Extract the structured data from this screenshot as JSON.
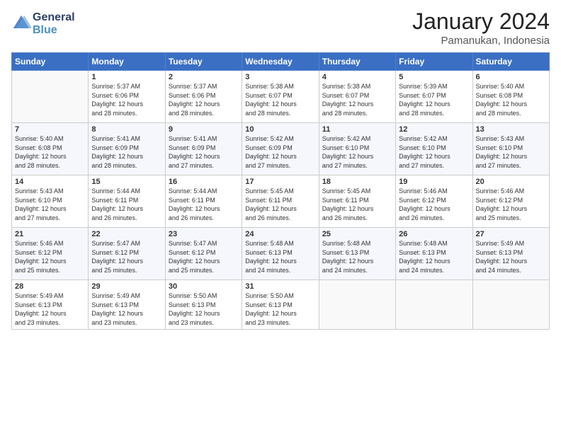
{
  "header": {
    "logo_line1": "General",
    "logo_line2": "Blue",
    "month_year": "January 2024",
    "location": "Pamanukan, Indonesia"
  },
  "days_of_week": [
    "Sunday",
    "Monday",
    "Tuesday",
    "Wednesday",
    "Thursday",
    "Friday",
    "Saturday"
  ],
  "weeks": [
    [
      {
        "day": "",
        "info": ""
      },
      {
        "day": "1",
        "info": "Sunrise: 5:37 AM\nSunset: 6:06 PM\nDaylight: 12 hours\nand 28 minutes."
      },
      {
        "day": "2",
        "info": "Sunrise: 5:37 AM\nSunset: 6:06 PM\nDaylight: 12 hours\nand 28 minutes."
      },
      {
        "day": "3",
        "info": "Sunrise: 5:38 AM\nSunset: 6:07 PM\nDaylight: 12 hours\nand 28 minutes."
      },
      {
        "day": "4",
        "info": "Sunrise: 5:38 AM\nSunset: 6:07 PM\nDaylight: 12 hours\nand 28 minutes."
      },
      {
        "day": "5",
        "info": "Sunrise: 5:39 AM\nSunset: 6:07 PM\nDaylight: 12 hours\nand 28 minutes."
      },
      {
        "day": "6",
        "info": "Sunrise: 5:40 AM\nSunset: 6:08 PM\nDaylight: 12 hours\nand 28 minutes."
      }
    ],
    [
      {
        "day": "7",
        "info": "Sunrise: 5:40 AM\nSunset: 6:08 PM\nDaylight: 12 hours\nand 28 minutes."
      },
      {
        "day": "8",
        "info": "Sunrise: 5:41 AM\nSunset: 6:09 PM\nDaylight: 12 hours\nand 28 minutes."
      },
      {
        "day": "9",
        "info": "Sunrise: 5:41 AM\nSunset: 6:09 PM\nDaylight: 12 hours\nand 27 minutes."
      },
      {
        "day": "10",
        "info": "Sunrise: 5:42 AM\nSunset: 6:09 PM\nDaylight: 12 hours\nand 27 minutes."
      },
      {
        "day": "11",
        "info": "Sunrise: 5:42 AM\nSunset: 6:10 PM\nDaylight: 12 hours\nand 27 minutes."
      },
      {
        "day": "12",
        "info": "Sunrise: 5:42 AM\nSunset: 6:10 PM\nDaylight: 12 hours\nand 27 minutes."
      },
      {
        "day": "13",
        "info": "Sunrise: 5:43 AM\nSunset: 6:10 PM\nDaylight: 12 hours\nand 27 minutes."
      }
    ],
    [
      {
        "day": "14",
        "info": "Sunrise: 5:43 AM\nSunset: 6:10 PM\nDaylight: 12 hours\nand 27 minutes."
      },
      {
        "day": "15",
        "info": "Sunrise: 5:44 AM\nSunset: 6:11 PM\nDaylight: 12 hours\nand 26 minutes."
      },
      {
        "day": "16",
        "info": "Sunrise: 5:44 AM\nSunset: 6:11 PM\nDaylight: 12 hours\nand 26 minutes."
      },
      {
        "day": "17",
        "info": "Sunrise: 5:45 AM\nSunset: 6:11 PM\nDaylight: 12 hours\nand 26 minutes."
      },
      {
        "day": "18",
        "info": "Sunrise: 5:45 AM\nSunset: 6:11 PM\nDaylight: 12 hours\nand 26 minutes."
      },
      {
        "day": "19",
        "info": "Sunrise: 5:46 AM\nSunset: 6:12 PM\nDaylight: 12 hours\nand 26 minutes."
      },
      {
        "day": "20",
        "info": "Sunrise: 5:46 AM\nSunset: 6:12 PM\nDaylight: 12 hours\nand 25 minutes."
      }
    ],
    [
      {
        "day": "21",
        "info": "Sunrise: 5:46 AM\nSunset: 6:12 PM\nDaylight: 12 hours\nand 25 minutes."
      },
      {
        "day": "22",
        "info": "Sunrise: 5:47 AM\nSunset: 6:12 PM\nDaylight: 12 hours\nand 25 minutes."
      },
      {
        "day": "23",
        "info": "Sunrise: 5:47 AM\nSunset: 6:12 PM\nDaylight: 12 hours\nand 25 minutes."
      },
      {
        "day": "24",
        "info": "Sunrise: 5:48 AM\nSunset: 6:13 PM\nDaylight: 12 hours\nand 24 minutes."
      },
      {
        "day": "25",
        "info": "Sunrise: 5:48 AM\nSunset: 6:13 PM\nDaylight: 12 hours\nand 24 minutes."
      },
      {
        "day": "26",
        "info": "Sunrise: 5:48 AM\nSunset: 6:13 PM\nDaylight: 12 hours\nand 24 minutes."
      },
      {
        "day": "27",
        "info": "Sunrise: 5:49 AM\nSunset: 6:13 PM\nDaylight: 12 hours\nand 24 minutes."
      }
    ],
    [
      {
        "day": "28",
        "info": "Sunrise: 5:49 AM\nSunset: 6:13 PM\nDaylight: 12 hours\nand 23 minutes."
      },
      {
        "day": "29",
        "info": "Sunrise: 5:49 AM\nSunset: 6:13 PM\nDaylight: 12 hours\nand 23 minutes."
      },
      {
        "day": "30",
        "info": "Sunrise: 5:50 AM\nSunset: 6:13 PM\nDaylight: 12 hours\nand 23 minutes."
      },
      {
        "day": "31",
        "info": "Sunrise: 5:50 AM\nSunset: 6:13 PM\nDaylight: 12 hours\nand 23 minutes."
      },
      {
        "day": "",
        "info": ""
      },
      {
        "day": "",
        "info": ""
      },
      {
        "day": "",
        "info": ""
      }
    ]
  ]
}
